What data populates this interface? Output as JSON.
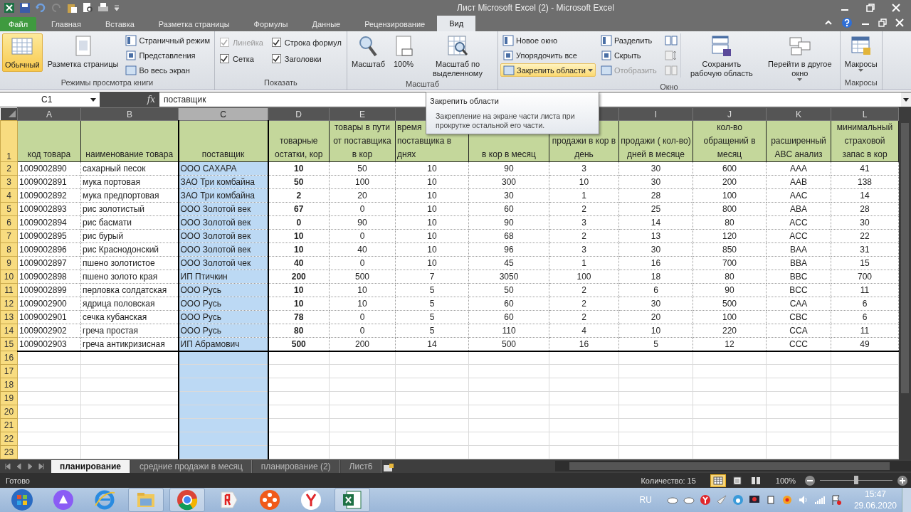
{
  "window": {
    "title": "Лист Microsoft Excel (2)  -  Microsoft Excel"
  },
  "ribbon_tabs": [
    {
      "label": "Файл",
      "kind": "file",
      "selected": false
    },
    {
      "label": "Главная",
      "kind": "tab",
      "selected": false
    },
    {
      "label": "Вставка",
      "kind": "tab",
      "selected": false
    },
    {
      "label": "Разметка страницы",
      "kind": "tab",
      "selected": false
    },
    {
      "label": "Формулы",
      "kind": "tab",
      "selected": false
    },
    {
      "label": "Данные",
      "kind": "tab",
      "selected": false
    },
    {
      "label": "Рецензирование",
      "kind": "tab",
      "selected": false
    },
    {
      "label": "Вид",
      "kind": "tab",
      "selected": true
    }
  ],
  "ribbon_groups": [
    {
      "label": "Режимы просмотра книги",
      "items": [
        {
          "kind": "large",
          "label": "Обычный",
          "selected": true
        },
        {
          "kind": "large",
          "label": "Разметка страницы",
          "selected": false
        },
        {
          "kind": "column",
          "buttons": [
            {
              "label": "Страничный режим",
              "disabled": false
            },
            {
              "label": "Представления",
              "disabled": false
            },
            {
              "label": "Во весь экран",
              "disabled": false
            }
          ]
        }
      ]
    },
    {
      "label": "Показать",
      "items": [
        {
          "kind": "checks",
          "checks": [
            {
              "label": "Линейка",
              "checked": true,
              "disabled": true
            },
            {
              "label": "Сетка",
              "checked": true,
              "disabled": false
            }
          ]
        },
        {
          "kind": "checks",
          "checks": [
            {
              "label": "Строка формул",
              "checked": true,
              "disabled": false
            },
            {
              "label": "Заголовки",
              "checked": true,
              "disabled": false
            }
          ]
        }
      ]
    },
    {
      "label": "Масштаб",
      "items": [
        {
          "kind": "large",
          "label": "Масштаб",
          "selected": false
        },
        {
          "kind": "large",
          "label": "100%",
          "selected": false
        },
        {
          "kind": "large",
          "label": "Масштаб по выделенному",
          "selected": false
        }
      ]
    },
    {
      "label": "Окно",
      "items": [
        {
          "kind": "column",
          "buttons": [
            {
              "label": "Новое окно",
              "disabled": false
            },
            {
              "label": "Упорядочить все",
              "disabled": false
            },
            {
              "label": "Закрепить области",
              "disabled": false,
              "highlighted": true,
              "dropdown": true
            }
          ]
        },
        {
          "kind": "column",
          "buttons": [
            {
              "label": "Разделить",
              "disabled": false
            },
            {
              "label": "Скрыть",
              "disabled": false
            },
            {
              "label": "Отобразить",
              "disabled": true
            }
          ]
        },
        {
          "kind": "icons"
        },
        {
          "kind": "large",
          "label": "Сохранить рабочую область",
          "selected": false
        },
        {
          "kind": "large",
          "label": "Перейти в другое окно",
          "selected": false,
          "dropdown": true
        }
      ]
    },
    {
      "label": "Макросы",
      "items": [
        {
          "kind": "large",
          "label": "Макросы",
          "selected": false,
          "dropdown": true
        }
      ]
    }
  ],
  "formula_bar": {
    "name_box": "C1",
    "fx": "fx",
    "value": "поставщик"
  },
  "tooltip": {
    "title": "Закрепить области",
    "text": "Закрепление на экране части листа при прокрутке остальной его части."
  },
  "columns": [
    {
      "letter": "A",
      "header": "код товара",
      "kind": "text",
      "selected": false
    },
    {
      "letter": "B",
      "header": "наименование товара",
      "kind": "text",
      "selected": false
    },
    {
      "letter": "C",
      "header": "поставщик",
      "kind": "text",
      "selected": true
    },
    {
      "letter": "D",
      "header": "товарные остатки, кор",
      "kind": "emphasis",
      "selected": false
    },
    {
      "letter": "E",
      "header": "товары в пути от поставщика в кор",
      "kind": "number",
      "selected": false
    },
    {
      "header": "время поставщика в днях",
      "kind": "number",
      "selected": false
    },
    {
      "header": "в кор в месяц",
      "kind": "number",
      "selected": false
    },
    {
      "header": "продажи в кор в день",
      "kind": "number",
      "selected": false
    },
    {
      "letter": "I",
      "header": "продажи ( кол-во) дней в месяце",
      "kind": "number",
      "selected": false
    },
    {
      "letter": "J",
      "header": "кол-во обращений в месяц",
      "kind": "number",
      "selected": false
    },
    {
      "letter": "K",
      "header": "расширенный ABC анализ",
      "kind": "number",
      "selected": false
    },
    {
      "letter": "L",
      "header": "минимальный страховой запас в  кор",
      "kind": "number",
      "selected": false
    }
  ],
  "header_row": "1",
  "rows": [
    {
      "row": "2",
      "cells": [
        "1009002890",
        "сахарный песок",
        "ООО САХАРА",
        "10",
        "50",
        "10",
        "90",
        "3",
        "30",
        "600",
        "AAA",
        "41"
      ]
    },
    {
      "row": "3",
      "cells": [
        "1009002891",
        "мука портовая",
        "ЗАО Три комбайна",
        "50",
        "100",
        "10",
        "300",
        "10",
        "30",
        "200",
        "AAB",
        "138"
      ]
    },
    {
      "row": "4",
      "cells": [
        "1009002892",
        "мука предпортовая",
        "ЗАО Три комбайна",
        "2",
        "20",
        "10",
        "30",
        "1",
        "28",
        "100",
        "AAC",
        "14"
      ]
    },
    {
      "row": "5",
      "cells": [
        "1009002893",
        "рис золотистый",
        "ООО Золотой век",
        "67",
        "0",
        "10",
        "60",
        "2",
        "25",
        "800",
        "ABA",
        "28"
      ]
    },
    {
      "row": "6",
      "cells": [
        "1009002894",
        "рис басмати",
        "ООО Золотой век",
        "0",
        "90",
        "10",
        "90",
        "3",
        "14",
        "80",
        "ACC",
        "30"
      ]
    },
    {
      "row": "7",
      "cells": [
        "1009002895",
        "рис бурый",
        "ООО Золотой век",
        "10",
        "0",
        "10",
        "68",
        "2",
        "13",
        "120",
        "ACC",
        "22"
      ]
    },
    {
      "row": "8",
      "cells": [
        "1009002896",
        "рис Краснодонский",
        "ООО Золотой век",
        "10",
        "40",
        "10",
        "96",
        "3",
        "30",
        "850",
        "BAA",
        "31"
      ]
    },
    {
      "row": "9",
      "cells": [
        "1009002897",
        "пшено золотистое",
        "ООО Золотой чек",
        "40",
        "0",
        "10",
        "45",
        "1",
        "16",
        "700",
        "BBA",
        "15"
      ]
    },
    {
      "row": "10",
      "cells": [
        "1009002898",
        "пшено золото края",
        "ИП Птичкин",
        "200",
        "500",
        "7",
        "3050",
        "100",
        "18",
        "80",
        "BBC",
        "700"
      ]
    },
    {
      "row": "11",
      "cells": [
        "1009002899",
        "перловка солдатская",
        "ООО Русь",
        "10",
        "10",
        "5",
        "50",
        "2",
        "6",
        "90",
        "BCC",
        "11"
      ]
    },
    {
      "row": "12",
      "cells": [
        "1009002900",
        "ядрица половская",
        "ООО Русь",
        "10",
        "10",
        "5",
        "60",
        "2",
        "30",
        "500",
        "CAA",
        "6"
      ]
    },
    {
      "row": "13",
      "cells": [
        "1009002901",
        "сечка кубанская",
        "ООО Русь",
        "78",
        "0",
        "5",
        "60",
        "2",
        "20",
        "100",
        "CBC",
        "6"
      ]
    },
    {
      "row": "14",
      "cells": [
        "1009002902",
        "греча простая",
        "ООО Русь",
        "80",
        "0",
        "5",
        "110",
        "4",
        "10",
        "220",
        "CCA",
        "11"
      ]
    },
    {
      "row": "15",
      "cells": [
        "1009002903",
        "греча антикризисная",
        "ИП Абрамович",
        "500",
        "200",
        "14",
        "500",
        "16",
        "5",
        "12",
        "CCC",
        "49"
      ]
    }
  ],
  "empty_rows": [
    "16",
    "17",
    "18",
    "19",
    "20",
    "21",
    "22",
    "23"
  ],
  "sheet_tabs": [
    {
      "label": "планирование",
      "selected": true
    },
    {
      "label": "средние продажи в месяц",
      "selected": false
    },
    {
      "label": "планирование (2)",
      "selected": false
    },
    {
      "label": "Лист6",
      "selected": false
    }
  ],
  "status_bar": {
    "ready": "Готово",
    "count": "Количество: 15",
    "view_buttons": [
      {
        "selected": true
      },
      {
        "selected": false
      },
      {
        "selected": false
      }
    ],
    "zoom": {
      "reading": "100%",
      "level": 0.5
    }
  },
  "taskbar": {
    "apps": [
      {
        "running": false
      },
      {
        "running": false
      },
      {
        "running": true
      },
      {
        "running": true
      },
      {
        "running": false
      },
      {
        "running": false
      },
      {
        "running": false
      },
      {
        "running": true
      }
    ],
    "language": "RU",
    "time": "15:47",
    "date": "29.06.2020"
  }
}
